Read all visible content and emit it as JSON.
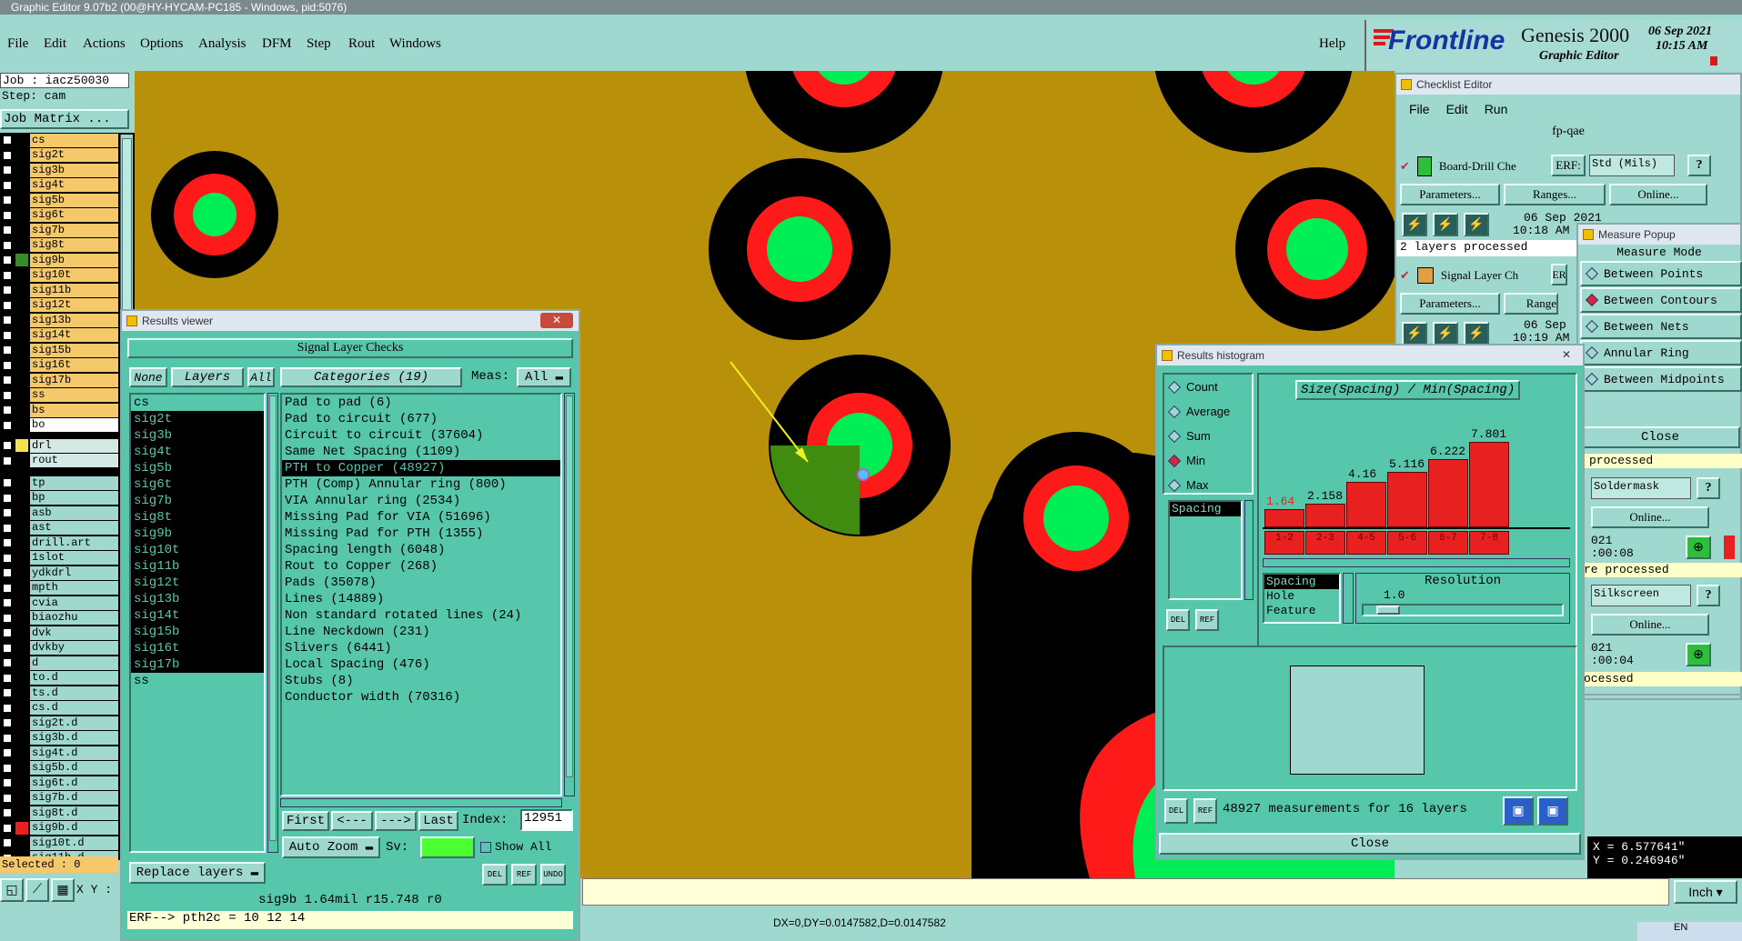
{
  "titlebar": {
    "text": "Graphic Editor 9.07b2 (00@HY-HYCAM-PC185 - Windows, pid:5076)"
  },
  "menu": {
    "items": [
      "File",
      "Edit",
      "Actions",
      "Options",
      "Analysis",
      "DFM",
      "Step",
      "Rout",
      "Windows"
    ],
    "help": "Help"
  },
  "logo": {
    "brand": "Frontline",
    "product": "Genesis 2000",
    "sub": "Graphic Editor",
    "date": "06 Sep 2021",
    "time": "10:15 AM"
  },
  "left": {
    "job": "Job : iacz50030",
    "step": "Step: cam",
    "job_matrix": "Job Matrix ...",
    "layers_top": [
      {
        "name": "cs",
        "color": "#f5c86a"
      },
      {
        "name": "sig2t",
        "color": "#f5c86a"
      },
      {
        "name": "sig3b",
        "color": "#f5c86a"
      },
      {
        "name": "sig4t",
        "color": "#f5c86a"
      },
      {
        "name": "sig5b",
        "color": "#f5c86a"
      },
      {
        "name": "sig6t",
        "color": "#f5c86a"
      },
      {
        "name": "sig7b",
        "color": "#f5c86a"
      },
      {
        "name": "sig8t",
        "color": "#f5c86a"
      },
      {
        "name": "sig9b",
        "color": "#f5c86a",
        "swatch": "#3a8c2a"
      },
      {
        "name": "sig10t",
        "color": "#f5c86a"
      },
      {
        "name": "sig11b",
        "color": "#f5c86a"
      },
      {
        "name": "sig12t",
        "color": "#f5c86a"
      },
      {
        "name": "sig13b",
        "color": "#f5c86a"
      },
      {
        "name": "sig14t",
        "color": "#f5c86a"
      },
      {
        "name": "sig15b",
        "color": "#f5c86a"
      },
      {
        "name": "sig16t",
        "color": "#f5c86a"
      },
      {
        "name": "sig17b",
        "color": "#f5c86a"
      },
      {
        "name": "ss",
        "color": "#f5c86a"
      },
      {
        "name": "bs",
        "color": "#f5c86a"
      },
      {
        "name": "bo",
        "color": "#ffffff"
      }
    ],
    "layers_mid": [
      {
        "name": "drl",
        "swatch": "#f5e14a"
      },
      {
        "name": "rout"
      }
    ],
    "layers_bot": [
      "tp",
      "bp",
      "asb",
      "ast",
      "drill.art",
      "1slot",
      "ydkdrl",
      "mpth",
      "cvia",
      "biaozhu",
      "dvk",
      "dvkby",
      "d",
      "to.d",
      "ts.d",
      "cs.d",
      "sig2t.d",
      "sig3b.d",
      "sig4t.d",
      "sig5b.d",
      "sig6t.d",
      "sig7b.d",
      "sig8t.d",
      "sig9b.d",
      "sig10t.d",
      "sig11b.d"
    ],
    "selected": "Selected : 0",
    "xy": "X Y :"
  },
  "results_viewer": {
    "title": "Results viewer",
    "header": "Signal Layer Checks",
    "none": "None",
    "layers": "Layers",
    "all": "All",
    "categories": "Categories (19)",
    "meas_label": "Meas:",
    "meas_value": "All",
    "layer_list": [
      "cs",
      "sig2t",
      "sig3b",
      "sig4t",
      "sig5b",
      "sig6t",
      "sig7b",
      "sig8t",
      "sig9b",
      "sig10t",
      "sig11b",
      "sig12t",
      "sig13b",
      "sig14t",
      "sig15b",
      "sig16t",
      "sig17b",
      "ss"
    ],
    "categories_list": [
      "Pad to pad (6)",
      "Pad to circuit (677)",
      "Circuit to circuit (37604)",
      "Same Net Spacing (1109)",
      "PTH to Copper (48927)",
      "PTH (Comp) Annular ring (800)",
      "VIA Annular ring (2534)",
      "Missing Pad for VIA (51696)",
      "Missing Pad for PTH (1355)",
      "Spacing length (6048)",
      "Rout to Copper (268)",
      "Pads (35078)",
      "Lines (14889)",
      "Non standard rotated lines (24)",
      "Line Neckdown (231)",
      "Slivers (6441)",
      "Local Spacing (476)",
      "Stubs (8)",
      "Conductor width (70316)"
    ],
    "first": "First",
    "prev": "<---",
    "next": "--->",
    "last": "Last",
    "index_label": "Index:",
    "index_value": "12951",
    "auto_zoom": "Auto Zoom",
    "sv": "Sv:",
    "show_all": "Show All",
    "replace_layers": "Replace layers",
    "info": "sig9b  1.64mil   r15.748   r0",
    "erf": "ERF--> pth2c = 10 12 14"
  },
  "histogram": {
    "title": "Results histogram",
    "modes": [
      {
        "label": "Count",
        "on": false
      },
      {
        "label": "Average",
        "on": false
      },
      {
        "label": "Sum",
        "on": false
      },
      {
        "label": "Min",
        "on": true
      },
      {
        "label": "Max",
        "on": false
      }
    ],
    "chart_title": "Size(Spacing) / Min(Spacing)",
    "list_item": "Spacing",
    "attrs": [
      "Spacing",
      "Hole",
      "Feature"
    ],
    "resolution_label": "Resolution",
    "resolution_value": "1.0",
    "summary": "48927 measurements for 16 layers",
    "close": "Close",
    "chart_data": {
      "type": "bar",
      "title": "Size(Spacing) / Min(Spacing)",
      "categories": [
        "1-2",
        "2-3",
        "4-5",
        "5-6",
        "6-7",
        "7-8"
      ],
      "values": [
        1.64,
        2.158,
        4.16,
        5.116,
        6.222,
        7.801
      ],
      "labels": [
        "1.64",
        "2.158",
        "4.16",
        "5.116",
        "6.222",
        "7.801"
      ],
      "bar_color": "#e82020"
    }
  },
  "checklist": {
    "title": "Checklist Editor",
    "menu": [
      "File",
      "Edit",
      "Run"
    ],
    "name": "fp-qae",
    "check1": "Board-Drill Che",
    "erf": "ERF:",
    "erf_val": "Std (Mils)",
    "params": "Parameters...",
    "ranges": "Ranges...",
    "online": "Online...",
    "date1": "06 Sep 2021",
    "time1": "10:18 AM",
    "processed1": "2 layers processed",
    "check2": "Signal Layer Ch",
    "erf2": "ER",
    "ranges2": "Range",
    "date2": "06 Sep",
    "time2": "10:19 AM",
    "processed_tail": "processed",
    "soldermask": "Soldermask",
    "online2": "Online...",
    "d2": "021",
    "t2": ":00:08",
    "re_processed": "re processed",
    "silkscreen": "Silkscreen",
    "online3": "Online...",
    "d3": "021",
    "t3": ":00:04",
    "ocessed": "ocessed"
  },
  "measure": {
    "title": "Measure Popup",
    "mode_label": "Measure Mode",
    "modes": [
      {
        "label": "Between Points",
        "on": false
      },
      {
        "label": "Between Contours",
        "on": true
      },
      {
        "label": "Between Nets",
        "on": false
      },
      {
        "label": "Annular Ring",
        "on": false
      },
      {
        "label": "Between Midpoints",
        "on": false
      }
    ],
    "close": "Close"
  },
  "status": {
    "dxdy": "DX=0,DY=0.0147582,D=0.0147582",
    "x": "X = 6.577641\"",
    "y": "Y = 0.246946\"",
    "units": "Inch",
    "lang": "EN"
  }
}
